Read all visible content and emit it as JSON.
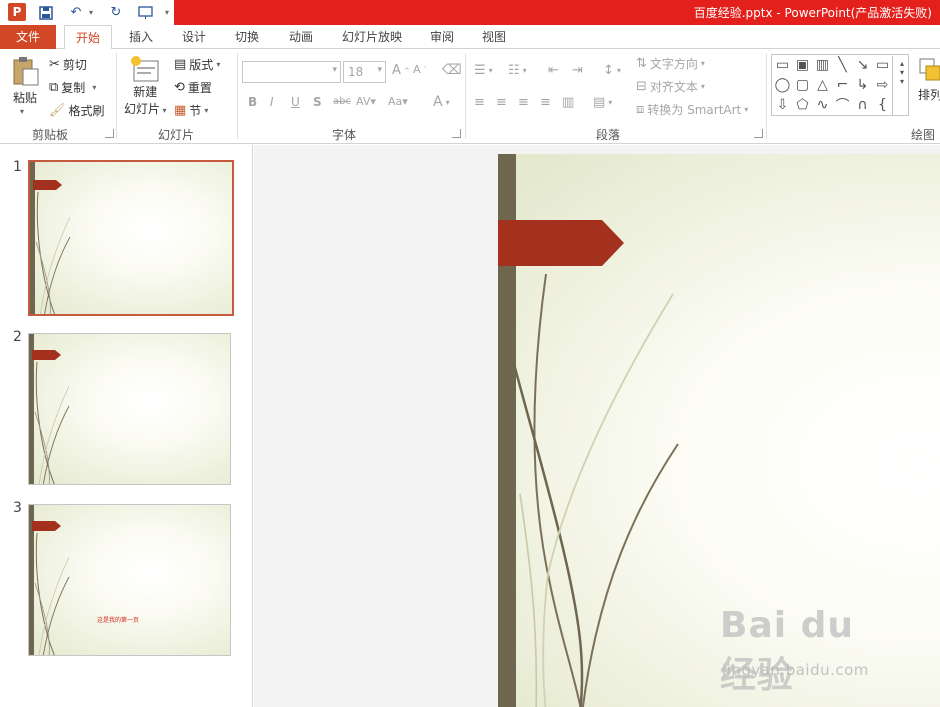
{
  "titlebar": {
    "title": "百度经验.pptx -   PowerPoint(产品激活失败)"
  },
  "qat": {
    "app_letter": "P"
  },
  "tabs": [
    {
      "label": "文件"
    },
    {
      "label": "开始"
    },
    {
      "label": "插入"
    },
    {
      "label": "设计"
    },
    {
      "label": "切换"
    },
    {
      "label": "动画"
    },
    {
      "label": "幻灯片放映"
    },
    {
      "label": "审阅"
    },
    {
      "label": "视图"
    }
  ],
  "ribbon": {
    "clipboard": {
      "paste": "粘贴",
      "cut": "剪切",
      "copy": "复制",
      "format_painter": "格式刷",
      "label": "剪贴板"
    },
    "slides": {
      "new_slide_line1": "新建",
      "new_slide_line2": "幻灯片",
      "layout": "版式",
      "reset": "重置",
      "section": "节",
      "label": "幻灯片"
    },
    "font": {
      "font_name": "",
      "font_size": "18",
      "label": "字体"
    },
    "paragraph": {
      "text_direction": "文字方向",
      "align_text": "对齐文本",
      "convert_smartart": "转换为 SmartArt",
      "label": "段落"
    },
    "drawing": {
      "arrange": "排列",
      "label": "绘图"
    }
  },
  "slides": [
    {
      "number": "1",
      "caption": ""
    },
    {
      "number": "2",
      "caption": ""
    },
    {
      "number": "3",
      "caption": "这是我的第一页"
    }
  ],
  "watermark": {
    "brand": "Bai du 经验",
    "url": "jingyan.baidu.com"
  },
  "colors": {
    "title_red": "#e3201b",
    "file_tab": "#d24726",
    "banner": "#a3311e",
    "bar": "#6f6650"
  }
}
